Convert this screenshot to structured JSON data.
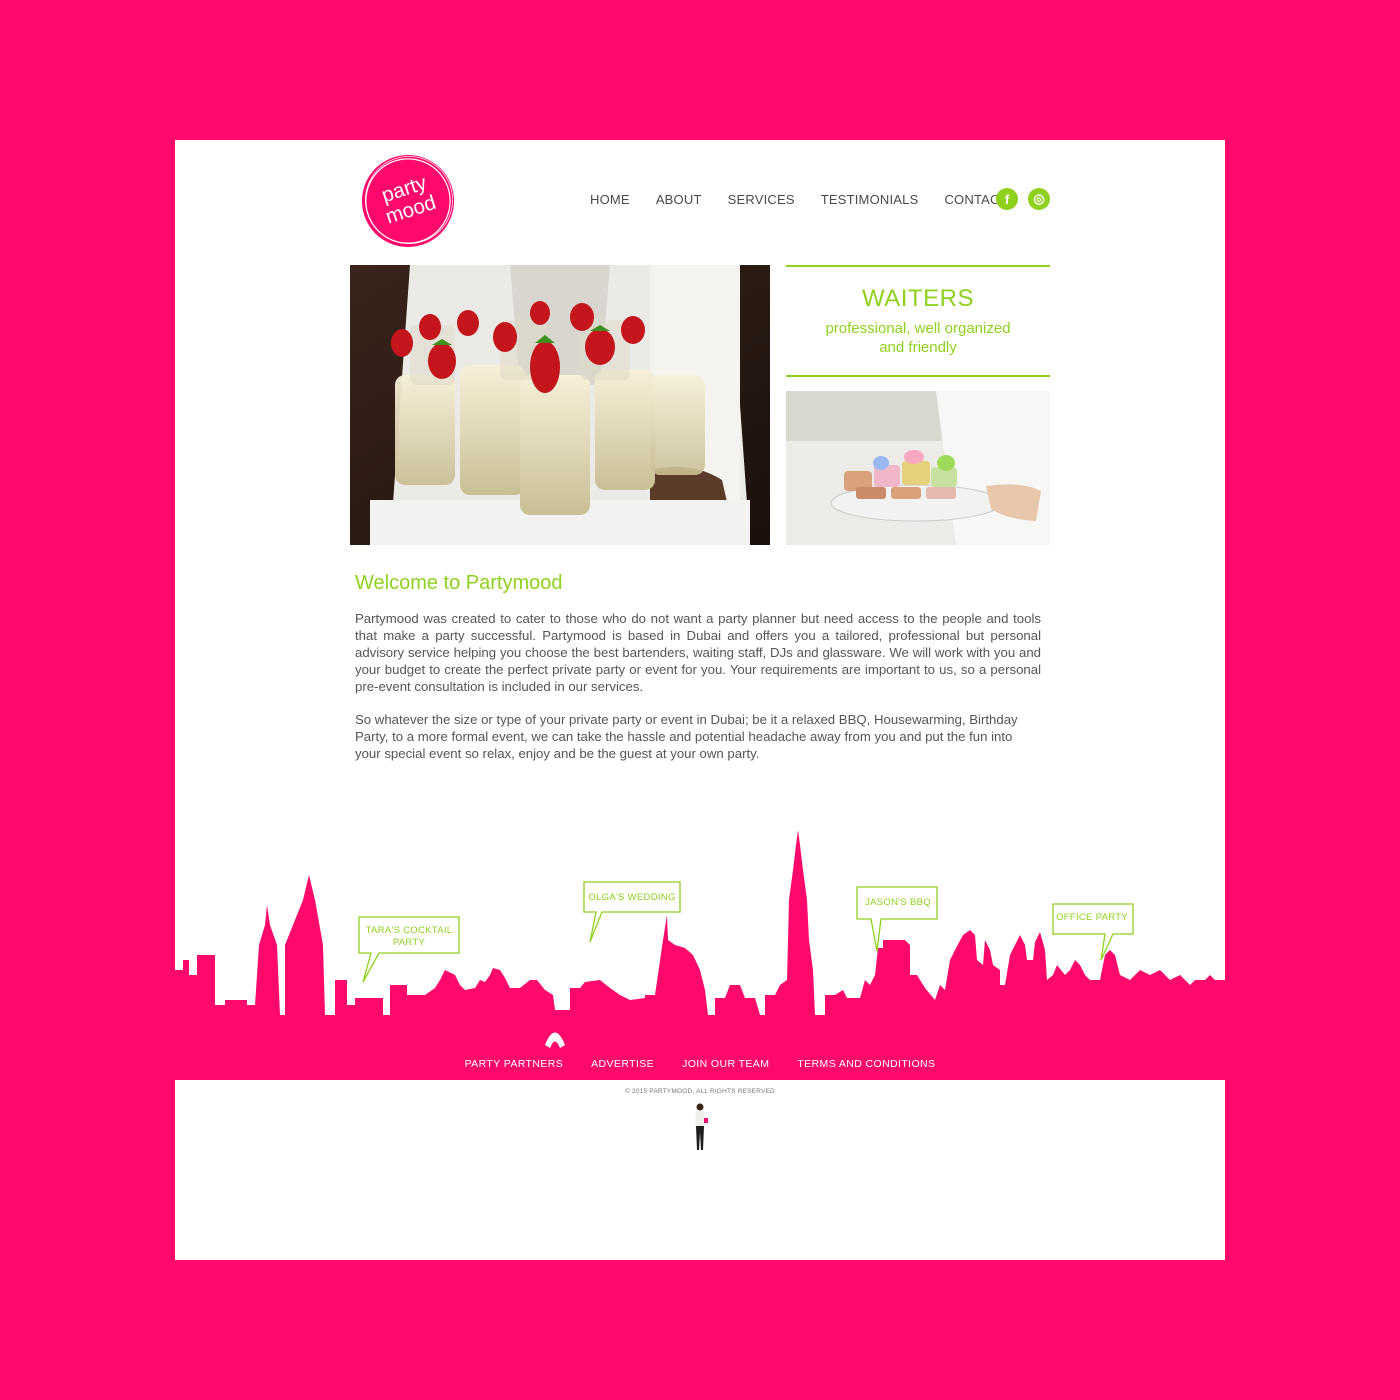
{
  "brand": {
    "logo_line1": "party",
    "logo_line2": "mood",
    "pink": "#ff0a6c",
    "green": "#8fd11d"
  },
  "nav": {
    "items": [
      {
        "label": "HOME"
      },
      {
        "label": "ABOUT"
      },
      {
        "label": "SERVICES"
      },
      {
        "label": "TESTIMONIALS"
      },
      {
        "label": "CONTACT"
      }
    ],
    "social": [
      {
        "icon": "facebook-icon",
        "glyph": "f"
      },
      {
        "icon": "instagram-icon",
        "glyph": "◎"
      }
    ]
  },
  "hero": {
    "title": "WAITERS",
    "subtitle": "professional, well organized and friendly"
  },
  "content": {
    "heading": "Welcome to Partymood",
    "paragraph1": "Partymood was created to cater to those who do not want a party planner but need access to the people and tools that make a party successful. Partymood is based in Dubai and offers you a tailored, professional but personal advisory service helping you choose the best bartenders, waiting staff, DJs and glassware. We will work with you and your budget to create the perfect private party or event for you. Your requirements are important to us, so a personal pre-event consultation is included in our services.",
    "paragraph2": "So whatever the size or type of your private party or event in Dubai; be it a relaxed BBQ, Housewarming, Birthday Party, to a more formal event, we can take the hassle and potential headache away from you and put the fun into your special event so relax, enjoy and be the guest at your own party."
  },
  "skyline": {
    "bubbles": [
      {
        "line1": "TARA'S COCKTAIL",
        "line2": "PARTY"
      },
      {
        "line1": "OLGA'S WEDDING",
        "line2": ""
      },
      {
        "line1": "JASON'S BBQ",
        "line2": ""
      },
      {
        "line1": "OFFICE PARTY",
        "line2": ""
      }
    ]
  },
  "footer": {
    "links": [
      {
        "label": "PARTY PARTNERS"
      },
      {
        "label": "ADVERTISE"
      },
      {
        "label": "JOIN OUR TEAM"
      },
      {
        "label": "TERMS AND CONDITIONS"
      }
    ],
    "copyright": "© 2015 PARTYMOOD, ALL RIGHTS RESERVED"
  }
}
